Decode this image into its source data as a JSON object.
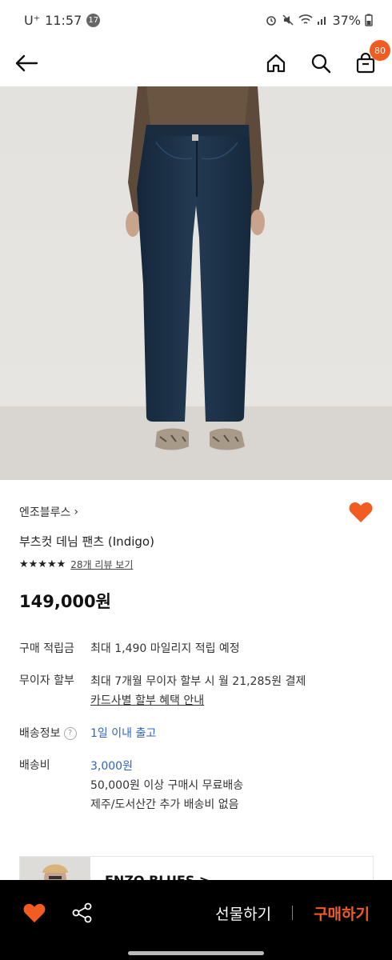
{
  "status_bar": {
    "carrier": "U⁺",
    "time": "11:57",
    "notification_count": "17",
    "battery": "37%"
  },
  "nav": {
    "cart_count": "80"
  },
  "product": {
    "brand": "엔조블루스",
    "brand_chevron": "›",
    "name": "부츠컷 데님 팬츠 (Indigo)",
    "stars": "★★★★★",
    "review_link": "28개 리뷰 보기",
    "price": "149,000원"
  },
  "details": {
    "points_label": "구매 적립금",
    "points_value": "최대 1,490 마일리지 적립 예정",
    "installment_label": "무이자 할부",
    "installment_value": "최대 7개월 무이자 할부 시 월 21,285원 결제",
    "installment_link": "카드사별 할부 혜택 안내",
    "shipping_label": "배송정보",
    "shipping_help": "?",
    "shipping_value": "1일 이내 출고",
    "fee_label": "배송비",
    "fee_value": "3,000원",
    "fee_note1": "50,000원 이상 구매시 무료배송",
    "fee_note2": "제주/도서산간 추가 배송비 없음"
  },
  "store_card": {
    "name": "ENZO BLUES >"
  },
  "bottom_bar": {
    "gift_label": "선물하기",
    "buy_label": "구매하기"
  },
  "colors": {
    "accent": "#f25c22",
    "link_blue": "#2f63c5"
  }
}
